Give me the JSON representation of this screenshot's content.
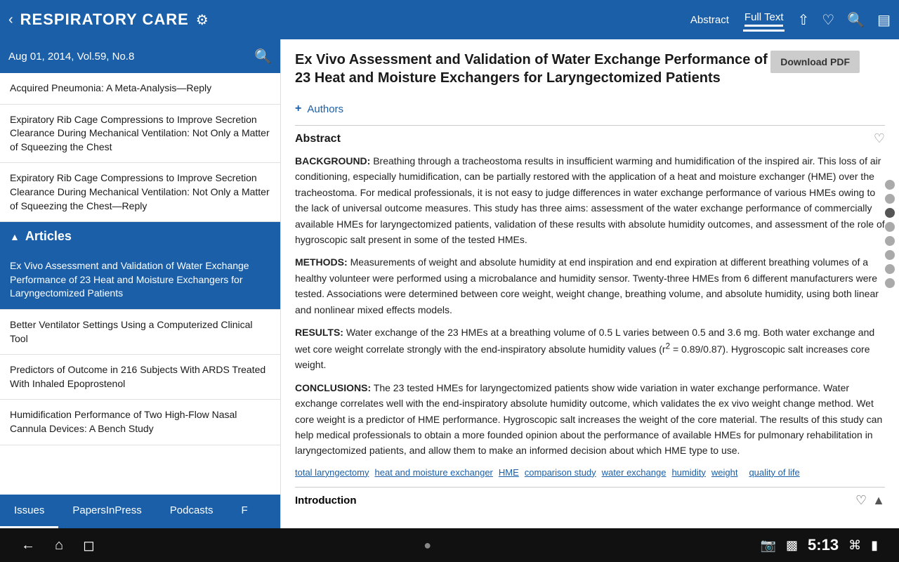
{
  "topBar": {
    "title": "RESPIRATORY CARE",
    "tabs": [
      {
        "label": "Abstract",
        "active": false
      },
      {
        "label": "Full Text",
        "active": true
      }
    ],
    "icons": [
      "share",
      "heart",
      "search",
      "chart"
    ]
  },
  "sidebar": {
    "date": "Aug 01, 2014, Vol.59, No.8",
    "articles": [
      {
        "id": 1,
        "text": "Acquired Pneumonia: A Meta-Analysis—Reply",
        "active": false
      },
      {
        "id": 2,
        "text": "Expiratory Rib Cage Compressions to Improve Secretion Clearance During Mechanical Ventilation: Not Only a Matter of Squeezing the Chest",
        "active": false
      },
      {
        "id": 3,
        "text": "Expiratory Rib Cage Compressions to Improve Secretion Clearance During Mechanical Ventilation: Not Only a Matter of Squeezing the Chest—Reply",
        "active": false
      }
    ],
    "sectionHeader": "Articles",
    "articlesList": [
      {
        "id": 4,
        "text": "Ex Vivo Assessment and Validation of Water Exchange Performance of 23 Heat and Moisture Exchangers for Laryngectomized Patients",
        "active": true
      },
      {
        "id": 5,
        "text": "Better Ventilator Settings Using a Computerized Clinical Tool",
        "active": false
      },
      {
        "id": 6,
        "text": "Predictors of Outcome in 216 Subjects With ARDS Treated With Inhaled Epoprostenol",
        "active": false
      },
      {
        "id": 7,
        "text": "Humidification Performance of Two High-Flow Nasal Cannula Devices: A Bench Study",
        "active": false
      }
    ],
    "bottomTabs": [
      {
        "label": "Issues",
        "active": true
      },
      {
        "label": "PapersInPress",
        "active": false
      },
      {
        "label": "Podcasts",
        "active": false
      },
      {
        "label": "F",
        "active": false
      }
    ]
  },
  "content": {
    "title": "Ex Vivo Assessment and Validation of Water Exchange Performance of 23 Heat and Moisture Exchangers for Laryngectomized Patients",
    "downloadBtn": "Download PDF",
    "authorsLabel": "Authors",
    "abstract": {
      "heading": "Abstract",
      "background": {
        "label": "BACKGROUND:",
        "text": "Breathing through a tracheostoma results in insufficient warming and humidification of the inspired air. This loss of air conditioning, especially humidification, can be partially restored with the application of a heat and moisture exchanger (HME) over the tracheostoma. For medical professionals, it is not easy to judge differences in water exchange performance of various HMEs owing to the lack of universal outcome measures. This study has three aims: assessment of the water exchange performance of commercially available HMEs for laryngectomized patients, validation of these results with absolute humidity outcomes, and assessment of the role of hygroscopic salt present in some of the tested HMEs."
      },
      "methods": {
        "label": "METHODS:",
        "text": "Measurements of weight and absolute humidity at end inspiration and end expiration at different breathing volumes of a healthy volunteer were performed using a microbalance and humidity sensor. Twenty-three HMEs from 6 different manufacturers were tested. Associations were determined between core weight, weight change, breathing volume, and absolute humidity, using both linear and nonlinear mixed effects models."
      },
      "results": {
        "label": "RESULTS:",
        "text": "Water exchange of the 23 HMEs at a breathing volume of 0.5 L varies between 0.5 and 3.6 mg. Both water exchange and wet core weight correlate strongly with the end-inspiratory absolute humidity values (r² = 0.89/0.87). Hygroscopic salt increases core weight."
      },
      "conclusions": {
        "label": "CONCLUSIONS:",
        "text": "The 23 tested HMEs for laryngectomized patients show wide variation in water exchange performance. Water exchange correlates well with the end-inspiratory absolute humidity outcome, which validates the ex vivo weight change method. Wet core weight is a predictor of HME performance. Hygroscopic salt increases the weight of the core material. The results of this study can help medical professionals to obtain a more founded opinion about the performance of available HMEs for pulmonary rehabilitation in laryngectomized patients, and allow them to make an informed decision about which HME type to use."
      }
    },
    "tags": [
      "total laryngectomy",
      "heat and moisture exchanger",
      "HME",
      "comparison study",
      "water exchange",
      "humidity",
      "weight",
      "quality of life"
    ],
    "introSection": "Introduction"
  },
  "systemBar": {
    "time": "5:13"
  }
}
